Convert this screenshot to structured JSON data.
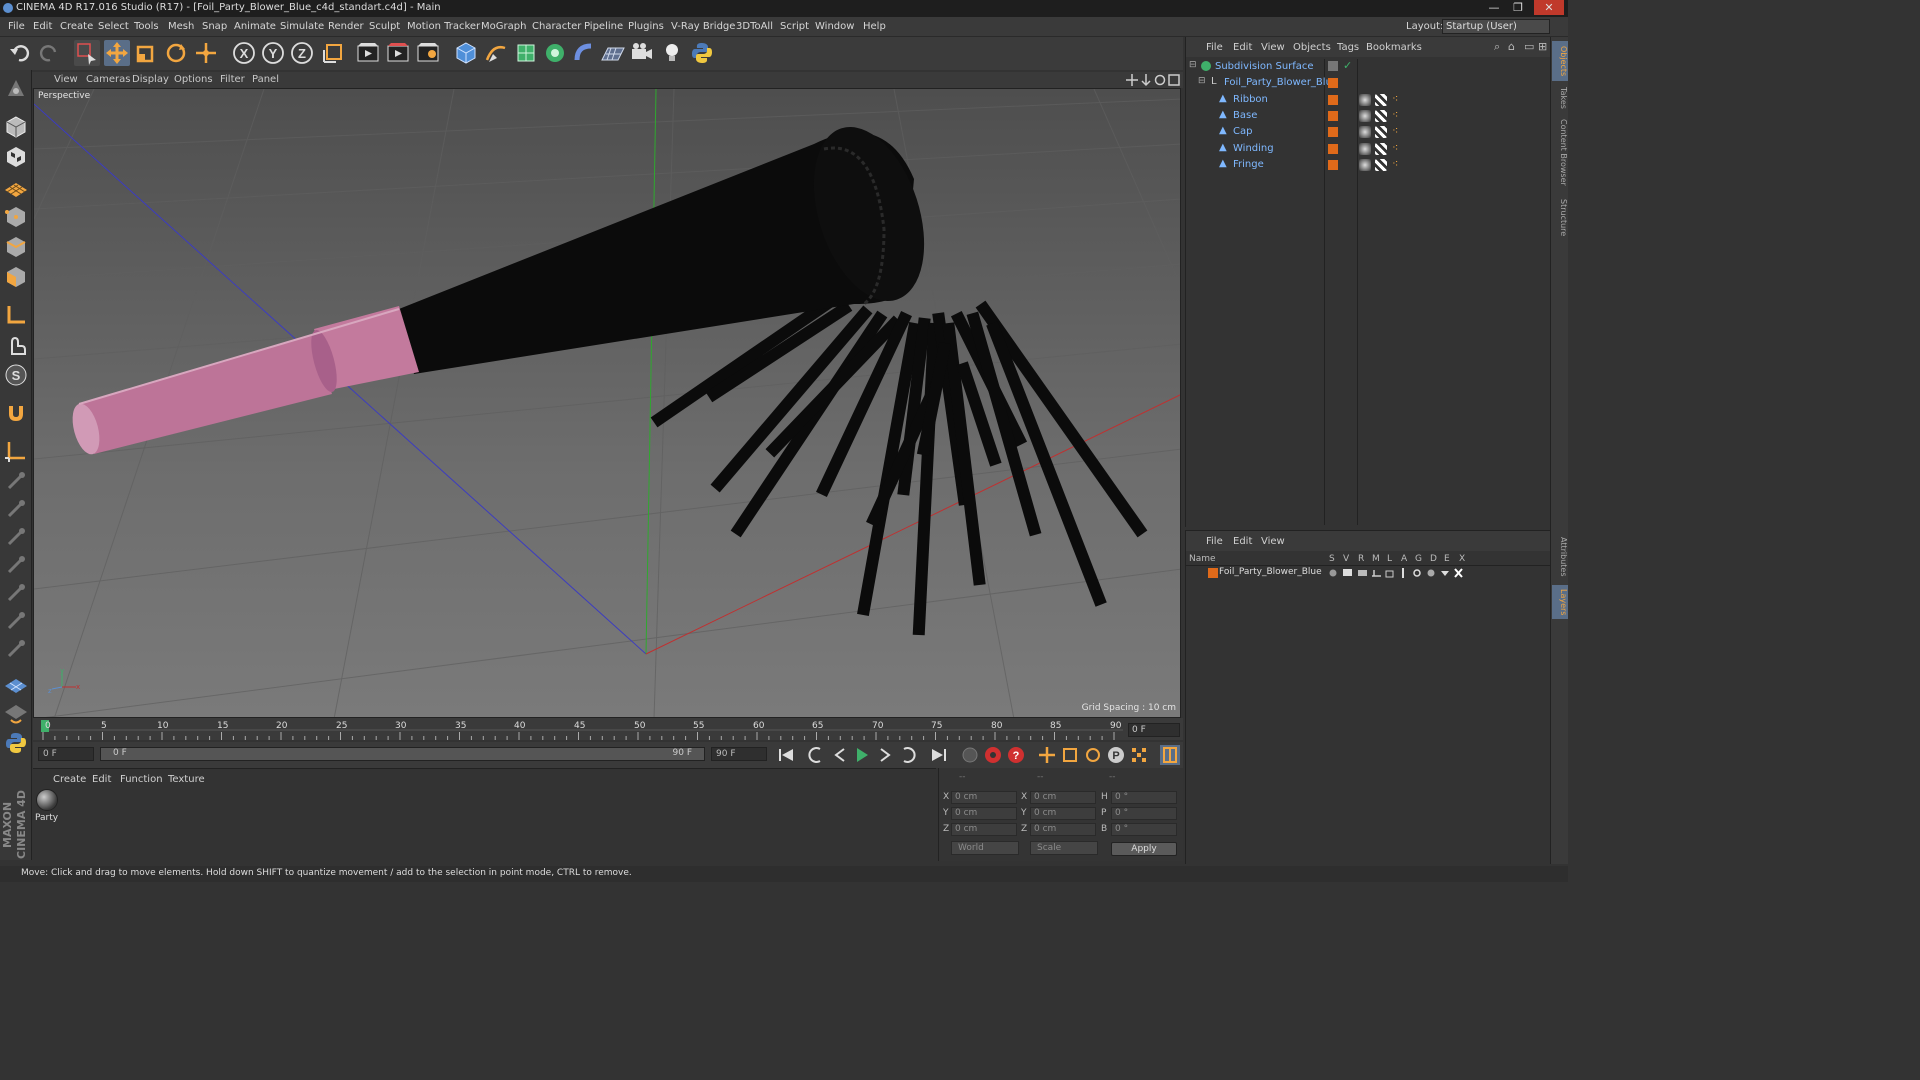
{
  "window": {
    "title": "CINEMA 4D R17.016 Studio (R17) - [Foil_Party_Blower_Blue_c4d_standart.c4d] - Main",
    "buttons": [
      "—",
      "❐",
      "✕"
    ]
  },
  "menu": {
    "items": [
      "File",
      "Edit",
      "Create",
      "Select",
      "Tools",
      "Mesh",
      "Snap",
      "Animate",
      "Simulate",
      "Render",
      "Sculpt",
      "Motion Tracker",
      "MoGraph",
      "Character",
      "Pipeline",
      "Plugins",
      "V-Ray Bridge",
      "3DToAll",
      "Script",
      "Window",
      "Help"
    ],
    "layout_label": "Layout:",
    "layout_value": "Startup (User)"
  },
  "viewport": {
    "menu": [
      "View",
      "Cameras",
      "Display",
      "Options",
      "Filter",
      "Panel"
    ],
    "label": "Perspective",
    "grid_spacing": "Grid Spacing : 10 cm"
  },
  "timeline": {
    "ticks": [
      "0",
      "5",
      "10",
      "15",
      "20",
      "25",
      "30",
      "35",
      "40",
      "45",
      "50",
      "55",
      "60",
      "65",
      "70",
      "75",
      "80",
      "85",
      "90"
    ],
    "current_frame": "0 F"
  },
  "transport": {
    "start_field": "0 F",
    "range_start": "0 F",
    "range_end": "90 F",
    "end_field": "90 F"
  },
  "materials": {
    "menu": [
      "Create",
      "Edit",
      "Function",
      "Texture"
    ],
    "items": [
      {
        "name": "Party"
      }
    ]
  },
  "coordinates": {
    "headers": [
      "--",
      "--",
      "--"
    ],
    "rows": [
      {
        "axis": "X",
        "pos": "0 cm",
        "axis2": "X",
        "size": "0 cm",
        "rot_axis": "H",
        "rot": "0 °"
      },
      {
        "axis": "Y",
        "pos": "0 cm",
        "axis2": "Y",
        "size": "0 cm",
        "rot_axis": "P",
        "rot": "0 °"
      },
      {
        "axis": "Z",
        "pos": "0 cm",
        "axis2": "Z",
        "size": "0 cm",
        "rot_axis": "B",
        "rot": "0 °"
      }
    ],
    "mode": "World",
    "scale_mode": "Scale",
    "apply_label": "Apply"
  },
  "objects": {
    "menu": [
      "File",
      "Edit",
      "View",
      "Objects",
      "Tags",
      "Bookmarks"
    ],
    "tree": [
      {
        "name": "Subdivision Surface",
        "level": 0
      },
      {
        "name": "Foil_Party_Blower_Blue",
        "level": 1
      },
      {
        "name": "Ribbon",
        "level": 2
      },
      {
        "name": "Base",
        "level": 2
      },
      {
        "name": "Cap",
        "level": 2
      },
      {
        "name": "Winding",
        "level": 2
      },
      {
        "name": "Fringe",
        "level": 2
      }
    ]
  },
  "layers": {
    "menu": [
      "File",
      "Edit",
      "View"
    ],
    "columns": [
      "Name",
      "S",
      "V",
      "R",
      "M",
      "L",
      "A",
      "G",
      "D",
      "E",
      "X"
    ],
    "items": [
      {
        "name": "Foil_Party_Blower_Blue",
        "color": "#e06a1a"
      }
    ]
  },
  "right_tabs": [
    "Objects",
    "Takes",
    "Content Browser",
    "Structure",
    "Attributes",
    "Layers"
  ],
  "status": {
    "text": "Move: Click and drag to move elements. Hold down SHIFT to quantize movement / add to the selection in point mode, CTRL to remove."
  },
  "branding": {
    "logo": "MAXON CINEMA 4D"
  },
  "colors": {
    "accent": "#5c8fd0",
    "object_name": "#7fb8ff",
    "layer_orange": "#e06a1a",
    "model_pink": "#c37a9d",
    "model_black": "#0b0b0b"
  }
}
